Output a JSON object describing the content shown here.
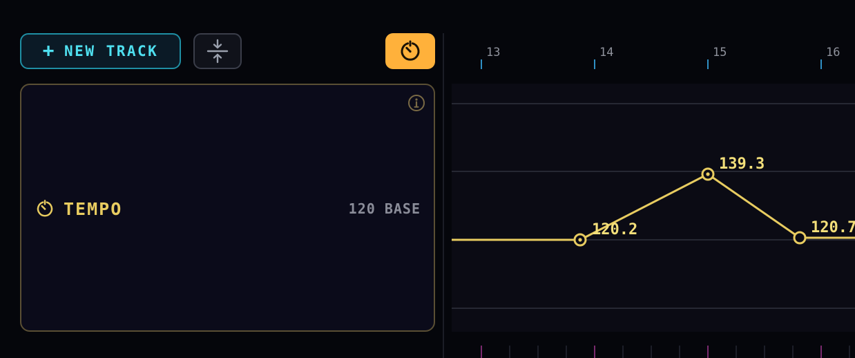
{
  "toolbar": {
    "new_track_label": "NEW TRACK",
    "new_track_icon": "plus-icon",
    "collapse_icon": "collapse-vertical-icon",
    "tempo_toggle_icon": "tempo-timer-icon"
  },
  "track": {
    "name": "TEMPO",
    "icon": "tempo-timer-icon",
    "base_value": "120 BASE",
    "info_icon": "info-icon"
  },
  "ruler": {
    "bars": [
      "13",
      "14",
      "15",
      "16"
    ]
  },
  "automation": {
    "points": [
      {
        "label": "120.2",
        "value": 120.2
      },
      {
        "label": "139.3",
        "value": 139.3
      },
      {
        "label": "120.7",
        "value": 120.7
      }
    ]
  },
  "colors": {
    "accent_cyan": "#4fe0f0",
    "accent_orange": "#ffb13b",
    "tempo_yellow": "#e8cc60",
    "background": "#05060b",
    "panel": "#0b0b1a"
  }
}
